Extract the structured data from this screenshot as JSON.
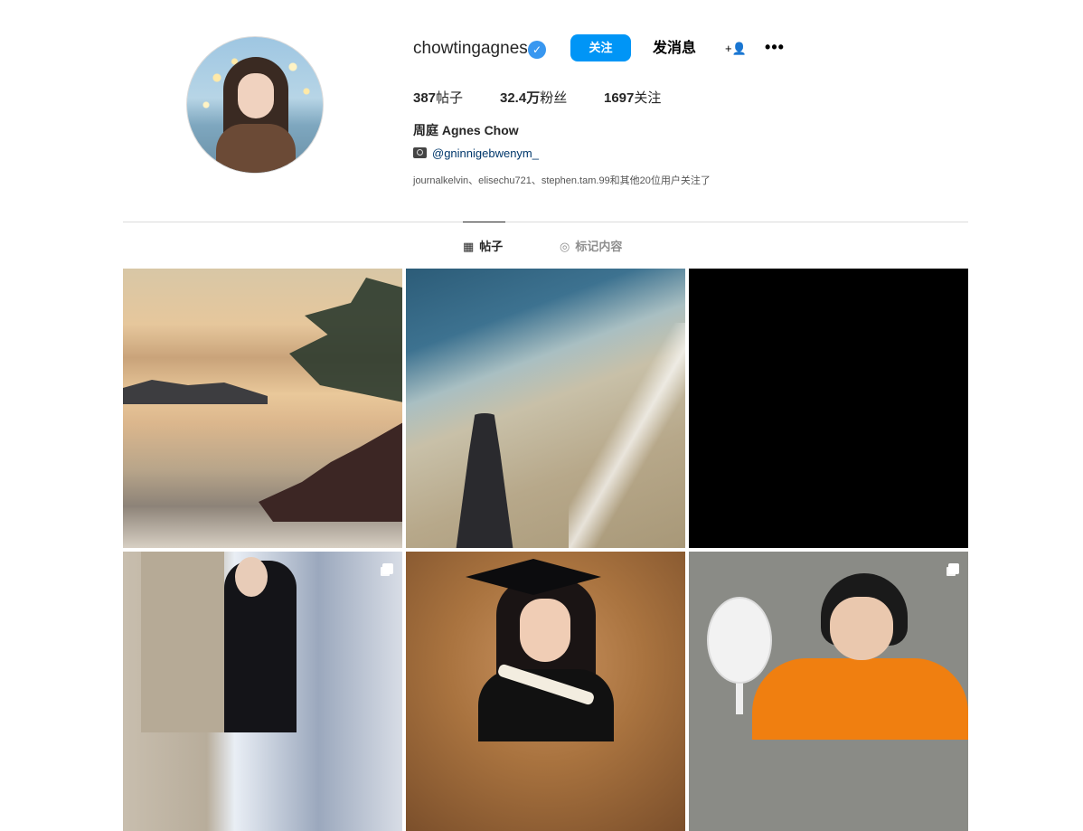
{
  "profile": {
    "username": "chowtingagnes",
    "verified_icon": "✓",
    "follow_label": "关注",
    "message_label": "发消息",
    "suggest_icon": "+👤",
    "more_icon": "•••",
    "stats": {
      "posts": "387",
      "posts_label": "帖子",
      "followers": "32.4万",
      "followers_label": "粉丝",
      "following": "1697",
      "following_label": "关注"
    },
    "full_name": "周庭 Agnes Chow",
    "link_text": "@gninnigebwenym_",
    "followed_by": "journalkelvin、elisechu721、stephen.tam.99和其他20位用户关注了"
  },
  "tabs": [
    {
      "icon": "▦",
      "label": "帖子",
      "active": true
    },
    {
      "icon": "◎",
      "label": "标记内容",
      "active": false
    }
  ],
  "grid": [
    {
      "desc": "painting-seascape",
      "multi": false
    },
    {
      "desc": "beach-shadow",
      "multi": false
    },
    {
      "desc": "black",
      "multi": false
    },
    {
      "desc": "woman-pillar",
      "multi": true
    },
    {
      "desc": "graduation-portrait",
      "multi": false
    },
    {
      "desc": "person-strainer",
      "multi": true
    }
  ],
  "colors": {
    "accent": "#0095f6",
    "verified": "#3897f0",
    "text": "#262626",
    "link": "#00376b"
  }
}
